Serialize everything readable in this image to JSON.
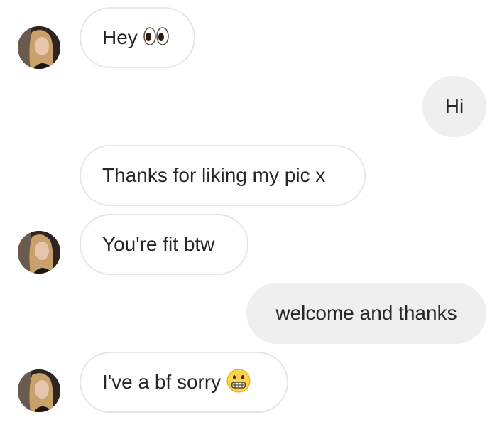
{
  "conversation": {
    "messages": [
      {
        "direction": "received",
        "text": "Hey",
        "emoji": "eyes-emoji",
        "show_avatar": true
      },
      {
        "direction": "sent",
        "text": "Hi"
      },
      {
        "direction": "received",
        "text": "Thanks for liking my pic x",
        "show_avatar": false
      },
      {
        "direction": "received",
        "text": "You're fit btw",
        "show_avatar": true
      },
      {
        "direction": "sent",
        "text": "welcome and thanks"
      },
      {
        "direction": "received",
        "text": "I've a bf sorry",
        "emoji": "grimacing-face-emoji",
        "show_avatar": true
      }
    ]
  },
  "colors": {
    "received_bubble_bg": "#ffffff",
    "received_bubble_border": "#e6e6e6",
    "sent_bubble_bg": "#efefef",
    "text": "#262626"
  }
}
